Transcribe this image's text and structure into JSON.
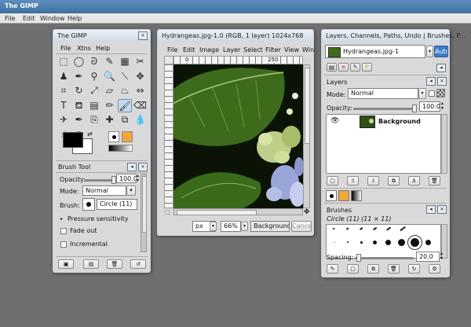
{
  "app": {
    "title": "The GIMP",
    "menu": [
      "File",
      "Edit",
      "Window",
      "Help"
    ]
  },
  "toolbox": {
    "title": "The GIMP",
    "menu": [
      "File",
      "Xtns",
      "Help"
    ],
    "tools": [
      {
        "name": "rect-select-icon",
        "glyph": "⬚"
      },
      {
        "name": "ellipse-select-icon",
        "glyph": "◯"
      },
      {
        "name": "free-select-icon",
        "glyph": "ᘐ"
      },
      {
        "name": "fuzzy-select-icon",
        "glyph": "✎"
      },
      {
        "name": "color-select-icon",
        "glyph": "▦"
      },
      {
        "name": "scissors-select-icon",
        "glyph": "✂"
      },
      {
        "name": "foreground-select-icon",
        "glyph": "♟"
      },
      {
        "name": "paths-icon",
        "glyph": "✒"
      },
      {
        "name": "color-picker-icon",
        "glyph": "⚲"
      },
      {
        "name": "magnify-icon",
        "glyph": "🔍"
      },
      {
        "name": "measure-icon",
        "glyph": "⟍"
      },
      {
        "name": "move-icon",
        "glyph": "✥"
      },
      {
        "name": "crop-icon",
        "glyph": "⌗"
      },
      {
        "name": "rotate-icon",
        "glyph": "↻"
      },
      {
        "name": "scale-icon",
        "glyph": "⤢"
      },
      {
        "name": "shear-icon",
        "glyph": "▱"
      },
      {
        "name": "perspective-icon",
        "glyph": "⏢"
      },
      {
        "name": "flip-icon",
        "glyph": "⇔"
      },
      {
        "name": "text-icon",
        "glyph": "T"
      },
      {
        "name": "bucket-fill-icon",
        "glyph": "⛾"
      },
      {
        "name": "blend-icon",
        "glyph": "▤"
      },
      {
        "name": "pencil-icon",
        "glyph": "✏"
      },
      {
        "name": "paintbrush-icon",
        "glyph": "🖌"
      },
      {
        "name": "eraser-icon",
        "glyph": "⌫"
      },
      {
        "name": "airbrush-icon",
        "glyph": "✈"
      },
      {
        "name": "ink-icon",
        "glyph": "✒"
      },
      {
        "name": "clone-icon",
        "glyph": "⎘"
      },
      {
        "name": "heal-icon",
        "glyph": "✚"
      },
      {
        "name": "perspective-clone-icon",
        "glyph": "⧉"
      },
      {
        "name": "blur-icon",
        "glyph": "💧"
      },
      {
        "name": "smudge-icon",
        "glyph": "☝"
      },
      {
        "name": "dodge-burn-icon",
        "glyph": "◐"
      }
    ],
    "selected_tool_index": 22,
    "fg_color": "#000000",
    "bg_color": "#ffffff"
  },
  "brush_tool": {
    "title": "Brush Tool",
    "opacity_label": "Opacity:",
    "opacity_value": "100.0",
    "mode_label": "Mode:",
    "mode_value": "Normal",
    "brush_label": "Brush:",
    "brush_value": "Circle (11)",
    "pressure_label": "Pressure sensitivity",
    "fade_label": "Fade out",
    "incremental_label": "Incremental"
  },
  "image_window": {
    "title": "Hydrangeas.jpg-1.0 (RGB, 1 layer) 1024x768",
    "menu": [
      "File",
      "Edit",
      "Image",
      "Layer",
      "Select",
      "Filter",
      "View",
      "Win"
    ],
    "ruler_ticks": [
      "0",
      "250"
    ],
    "unit": "px",
    "zoom": "66%",
    "status": "Background (6",
    "cancel_label": "Cancel"
  },
  "dock": {
    "title": "Layers, Channels, Paths, Undo | Brushes, P...",
    "image_name": "Hydrangeas.jpg-1",
    "auto_label": "Auto",
    "layers": {
      "title": "Layers",
      "mode_label": "Mode:",
      "mode_value": "Normal",
      "opacity_label": "Opacity:",
      "opacity_value": "100.0",
      "items": [
        {
          "name": "Background"
        }
      ]
    },
    "brushes": {
      "title": "Brushes",
      "current": "Circle (11) (11 × 11)",
      "spacing_label": "Spacing:",
      "spacing_value": "20.0"
    }
  }
}
